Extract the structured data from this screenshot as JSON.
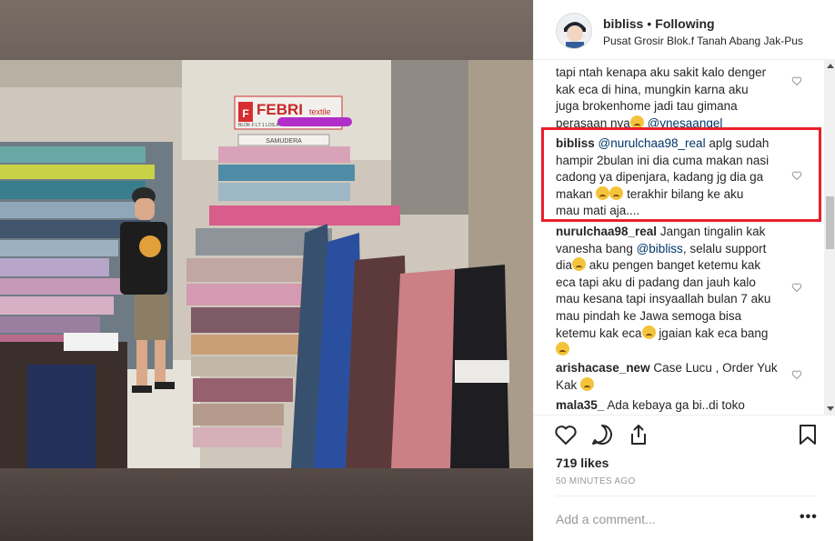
{
  "post": {
    "username": "bibliss",
    "follow_separator": "•",
    "follow_status": "Following",
    "location": "Pusat Grosir Blok.f Tanah Abang Jak-Pus",
    "photo_sign_text": "FEBRI",
    "photo_sign_sub": "textile",
    "photo_sign_small": "BLOK F LT 1 LOS A4",
    "photo_sign2_text": "SAMUDERA"
  },
  "comments": [
    {
      "text_lines": [
        "tapi ntah kenapa aku sakit kalo denger",
        "kak eca di hina, mungkin karna aku",
        "juga brokenhome jadi tau gimana"
      ],
      "last_line_prefix": "perasaan nya",
      "last_line_mention": "@ynesaangel"
    },
    {
      "username": "bibliss",
      "mention": "@nurulchaa98_real",
      "line1_rest": "aplg sudah",
      "line2": "hampir 2bulan ini dia cuma makan nasi",
      "line3": "cadong ya dipenjara, kadang jg dia ga",
      "line4_prefix": "makan",
      "line4_suffix": "terakhir bilang ke aku",
      "line5": "mau mati aja...."
    },
    {
      "username": "nurulchaa98_real",
      "line1_rest": "Jangan tingalin kak",
      "line2_prefix": "vanesha bang",
      "line2_mention": "@bibliss",
      "line2_suffix": ", selalu support",
      "line3_prefix": "dia",
      "line3_suffix": "aku pengen banget ketemu kak",
      "line4": "eca tapi aku di padang dan jauh kalo",
      "line5": "mau kesana tapi insyaallah bulan 7 aku",
      "line6": "mau pindah ke Jawa semoga bisa",
      "line7_prefix": "ketemu kak eca",
      "line7_suffix": "jgaian kak eca bang"
    },
    {
      "username": "arishacase_new",
      "line1_rest": "Case Lucu , Order Yuk",
      "line2": "Kak"
    },
    {
      "username": "mala35_",
      "line1_rest": "Ada kebaya ga bi..di toko"
    }
  ],
  "likes": "719 likes",
  "time_ago": "50 MINUTES AGO",
  "add_comment_placeholder": "Add a comment...",
  "more_label": "•••",
  "colors": {
    "highlight_border": "#e8202a",
    "mention": "#003569",
    "muted": "#999999"
  },
  "icons": [
    "heart-icon",
    "comment-icon",
    "share-icon",
    "bookmark-icon",
    "more-icon"
  ]
}
